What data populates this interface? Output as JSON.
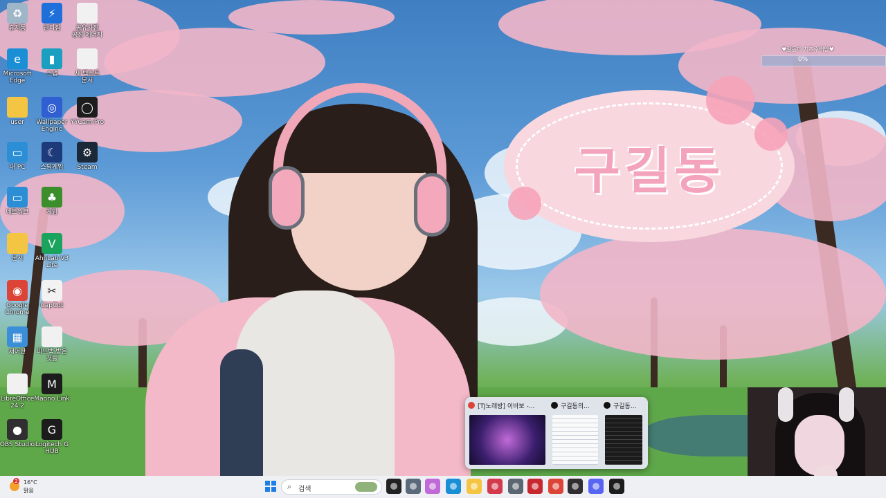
{
  "desktop": {
    "wallpaper_banner_text": "구길동",
    "icons": [
      {
        "id": "recycle",
        "label": "휴지통",
        "icon": "recycle-bin-icon",
        "color": "#9fb6c9",
        "glyph": "♻"
      },
      {
        "id": "bandizip",
        "label": "반디집",
        "icon": "bandizip-icon",
        "color": "#1e6fd9",
        "glyph": "⚡"
      },
      {
        "id": "doc1",
        "label": "공유사전\n공정 에너지",
        "icon": "document-icon",
        "color": "#f1f1f1",
        "glyph": ""
      },
      {
        "id": "edge",
        "label": "Microsoft\nEdge",
        "icon": "edge-icon",
        "color": "#1a8fd6",
        "glyph": "e"
      },
      {
        "id": "app2",
        "label": "스냅",
        "icon": "app-icon",
        "color": "#1b9fc0",
        "glyph": "▮"
      },
      {
        "id": "doc2",
        "label": "새 텍스트\n문서",
        "icon": "text-document-icon",
        "color": "#f1f1f1",
        "glyph": ""
      },
      {
        "id": "user",
        "label": "user",
        "icon": "folder-icon",
        "color": "#f4c542",
        "glyph": ""
      },
      {
        "id": "wallpaper",
        "label": "Wallpaper\nEngine",
        "icon": "wallpaper-engine-icon",
        "color": "#2f5fd0",
        "glyph": "◎"
      },
      {
        "id": "yycam",
        "label": "YYCam Pro",
        "icon": "yycam-icon",
        "color": "#1d1d1d",
        "glyph": "◯"
      },
      {
        "id": "pc",
        "label": "내 PC",
        "icon": "computer-icon",
        "color": "#2c8fd6",
        "glyph": "▭"
      },
      {
        "id": "sleep",
        "label": "스팀게임",
        "icon": "moon-icon",
        "color": "#1d3a7a",
        "glyph": "☾"
      },
      {
        "id": "steam",
        "label": "Steam",
        "icon": "steam-icon",
        "color": "#1b2838",
        "glyph": "⚙"
      },
      {
        "id": "network",
        "label": "네트워크",
        "icon": "network-icon",
        "color": "#2c8fd6",
        "glyph": "▭"
      },
      {
        "id": "game",
        "label": "게임",
        "icon": "tree-icon",
        "color": "#3a8f2a",
        "glyph": "♣"
      },
      {
        "id": "docs",
        "label": "문서",
        "icon": "folder-icon",
        "color": "#f4c542",
        "glyph": ""
      },
      {
        "id": "ahnlab",
        "label": "AhnLab V3\nLite",
        "icon": "ahnlab-icon",
        "color": "#1aa35c",
        "glyph": "V"
      },
      {
        "id": "chrome",
        "label": "Google\nChrome",
        "icon": "chrome-icon",
        "color": "#db4437",
        "glyph": "◉"
      },
      {
        "id": "capcut",
        "label": "CapCut",
        "icon": "capcut-icon",
        "color": "#f2f2f2",
        "glyph": "✂"
      },
      {
        "id": "control",
        "label": "제어판",
        "icon": "control-panel-icon",
        "color": "#3b8fd8",
        "glyph": "▦"
      },
      {
        "id": "feedback",
        "label": "피드백 받은\n것들",
        "icon": "document-icon",
        "color": "#f1f1f1",
        "glyph": ""
      },
      {
        "id": "libre",
        "label": "LibreOffice\n24.2",
        "icon": "libreoffice-icon",
        "color": "#f1f1f1",
        "glyph": ""
      },
      {
        "id": "maono",
        "label": "Maono Link",
        "icon": "maono-icon",
        "color": "#1c1c1c",
        "glyph": "M"
      },
      {
        "id": "obs",
        "label": "OBS Studio",
        "icon": "obs-icon",
        "color": "#302e31",
        "glyph": "●"
      },
      {
        "id": "logitech",
        "label": "Logitech G\nHUB",
        "icon": "logitech-icon",
        "color": "#1c1c1c",
        "glyph": "G"
      }
    ]
  },
  "widget": {
    "title": "♥길동이 치즈주배앙♥",
    "percent": "0%",
    "progress": 0
  },
  "taskbar_preview": {
    "items": [
      {
        "title": "[TJ노래방] 이바보 -...",
        "icon": "chrome-icon"
      },
      {
        "title": "구길동의...",
        "icon": "app-icon"
      },
      {
        "title": "구길동...",
        "icon": "app-icon"
      }
    ]
  },
  "taskbar": {
    "weather": {
      "temp": "16°C",
      "condition": "맑음",
      "badge": "2"
    },
    "search_placeholder": "검색",
    "start_icon": "windows-start-icon",
    "apps": [
      {
        "name": "task-view",
        "icon": "task-view-icon",
        "color": "#222"
      },
      {
        "name": "calculator",
        "icon": "calculator-icon",
        "color": "#5b6a7a"
      },
      {
        "name": "copilot",
        "icon": "copilot-icon",
        "color": "#c06ad8"
      },
      {
        "name": "edge",
        "icon": "edge-icon",
        "color": "#1a8fd6"
      },
      {
        "name": "explorer",
        "icon": "folder-icon",
        "color": "#f4c542"
      },
      {
        "name": "snipping",
        "icon": "snipping-tool-icon",
        "color": "#d33a4b"
      },
      {
        "name": "settings",
        "icon": "gear-icon",
        "color": "#5c6670"
      },
      {
        "name": "vmix",
        "icon": "video-mixer-icon",
        "color": "#c7282f"
      },
      {
        "name": "chrome",
        "icon": "chrome-icon",
        "color": "#db4437"
      },
      {
        "name": "obs",
        "icon": "obs-icon",
        "color": "#302e31"
      },
      {
        "name": "discord",
        "icon": "discord-icon",
        "color": "#5865f2"
      },
      {
        "name": "yycam",
        "icon": "yycam-icon",
        "color": "#1d1d1d"
      }
    ]
  }
}
